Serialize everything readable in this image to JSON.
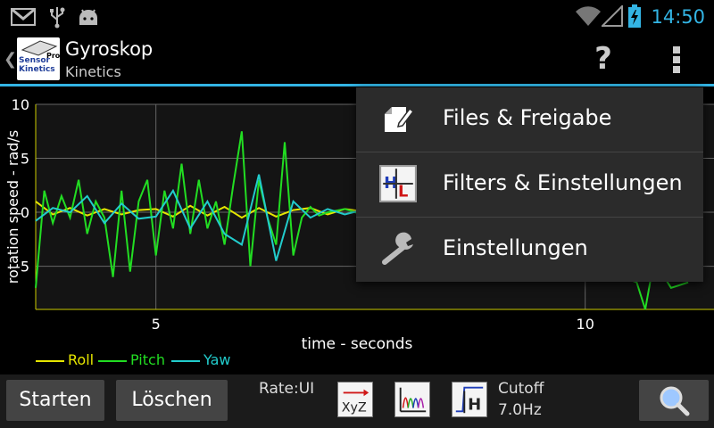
{
  "status_bar": {
    "time": "14:50",
    "icons": [
      "gmail-icon",
      "usb-icon",
      "android-debug-icon",
      "wifi-icon",
      "signal-icon",
      "battery-charging-icon"
    ],
    "accent_color": "#33b5e5"
  },
  "action_bar": {
    "title": "Gyroskop",
    "subtitle": "Kinetics",
    "app_icon_text": [
      "Sensor",
      "Kinetics",
      "Pro"
    ],
    "help_label": "?"
  },
  "menu": {
    "items": [
      {
        "label": "Files & Freigabe",
        "icon": "file-share-icon"
      },
      {
        "label": "Filters & Einstellungen",
        "icon": "filter-hl-icon"
      },
      {
        "label": "Einstellungen",
        "icon": "wrench-icon"
      }
    ]
  },
  "chart_data": {
    "type": "line",
    "xlabel": "time - seconds",
    "ylabel": "rotation speed - rad/s",
    "xlim": [
      3.6,
      11.5
    ],
    "ylim": [
      -9,
      10
    ],
    "x_ticks": [
      5,
      10
    ],
    "y_ticks": [
      10,
      5,
      0,
      -5
    ],
    "grid": true,
    "legend_position": "bottom-left",
    "series": [
      {
        "name": "Roll",
        "color": "#e6e600",
        "x": [
          3.6,
          3.8,
          4.0,
          4.2,
          4.4,
          4.6,
          4.8,
          5.0,
          5.2,
          5.4,
          5.6,
          5.8,
          6.0,
          6.2,
          6.4,
          6.6,
          6.8,
          7.0,
          7.2,
          7.4,
          7.6,
          7.8,
          8.0,
          8.2,
          8.4
        ],
        "y": [
          1.0,
          -0.2,
          0.4,
          -0.3,
          0.3,
          -0.2,
          0.2,
          0.3,
          -0.4,
          0.6,
          -0.3,
          0.5,
          -0.5,
          0.4,
          -0.4,
          0.2,
          0.4,
          -0.2,
          0.3,
          0.1,
          -0.3,
          0.2,
          0.4,
          -0.1,
          0.2
        ]
      },
      {
        "name": "Pitch",
        "color": "#22dd22",
        "x": [
          3.6,
          3.7,
          3.8,
          3.9,
          4.0,
          4.1,
          4.2,
          4.3,
          4.4,
          4.5,
          4.6,
          4.7,
          4.8,
          4.9,
          5.0,
          5.1,
          5.2,
          5.3,
          5.4,
          5.5,
          5.6,
          5.7,
          5.8,
          5.9,
          6.0,
          6.1,
          6.2,
          6.3,
          6.4,
          6.5,
          6.6,
          6.7,
          6.8,
          6.9,
          7.0,
          7.2,
          7.4,
          7.6,
          7.8,
          8.0,
          8.2,
          8.4,
          10.6,
          10.7,
          10.8,
          11.0,
          11.2
        ],
        "y": [
          -7.0,
          2.0,
          -1.0,
          1.5,
          -0.5,
          3.0,
          -2.0,
          1.0,
          -0.5,
          -6.0,
          2.0,
          -5.5,
          1.0,
          3.0,
          -4.0,
          2.0,
          -1.5,
          4.5,
          -2.0,
          3.0,
          -1.5,
          1.0,
          -3.0,
          2.5,
          7.5,
          -5.0,
          3.0,
          -0.5,
          -3.0,
          6.5,
          -4.0,
          -0.5,
          0.5,
          -0.3,
          0.0,
          0.3,
          -0.2,
          0.1,
          -0.3,
          0.2,
          2.0,
          0.5,
          -6.5,
          -9.0,
          -4.5,
          -7.0,
          -6.5
        ]
      },
      {
        "name": "Yaw",
        "color": "#22cccc",
        "x": [
          3.6,
          3.8,
          4.0,
          4.2,
          4.4,
          4.6,
          4.8,
          5.0,
          5.2,
          5.4,
          5.6,
          5.8,
          6.0,
          6.2,
          6.4,
          6.6,
          6.8,
          7.0,
          7.2,
          7.4,
          7.6,
          7.8,
          8.0,
          8.2,
          8.4
        ],
        "y": [
          -0.8,
          0.4,
          0.0,
          1.5,
          -1.0,
          0.8,
          -0.6,
          -0.4,
          2.0,
          -1.5,
          1.0,
          -2.0,
          -3.0,
          3.5,
          -4.5,
          1.0,
          -0.5,
          0.3,
          -0.2,
          0.2,
          0.4,
          -0.3,
          0.2,
          -2.0,
          1.0
        ]
      }
    ]
  },
  "bottom_bar": {
    "start_label": "Starten",
    "clear_label": "Löschen",
    "rate_label": "Rate:UI",
    "cutoff_label": "Cutoff",
    "cutoff_value": "7.0Hz",
    "tools": [
      "xyz-axis-icon",
      "filter-bank-icon",
      "highpass-filter-icon"
    ],
    "zoom_icon": "zoom-icon"
  }
}
